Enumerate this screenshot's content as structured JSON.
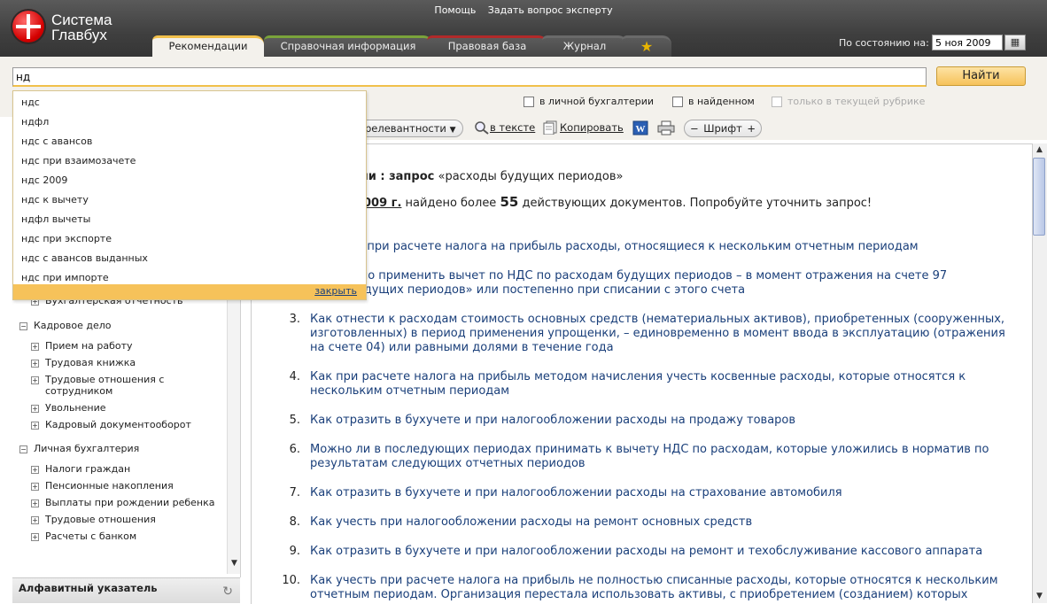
{
  "logo": {
    "line1": "Система",
    "line2": "Главбух"
  },
  "top_links": {
    "help": "Помощь",
    "ask_expert": "Задать вопрос эксперту"
  },
  "tabs": [
    {
      "label": "Рекомендации"
    },
    {
      "label": "Справочная информация"
    },
    {
      "label": "Правовая база"
    },
    {
      "label": "Журнал"
    },
    {
      "label": "★"
    }
  ],
  "date": {
    "label": "По состоянию на:",
    "value": "5 ноя 2009"
  },
  "search": {
    "value": "нд",
    "button": "Найти"
  },
  "filters": {
    "personal": "в личной бухгалтерии",
    "found": "в найденном",
    "rubric": "только в текущей рубрике"
  },
  "toolbar": {
    "sort": "релевантности",
    "in_text": "в тексте",
    "copy": "Копировать",
    "font_minus": "−",
    "font": "Шрифт",
    "font_plus": "+"
  },
  "autocomplete": {
    "items": [
      "ндс",
      "ндфл",
      "ндс с авансов",
      "ндс при взаимозачете",
      "ндс 2009",
      "ндс к вычету",
      "ндфл вычеты",
      "ндс при экспорте",
      "ндс с авансов выданных",
      "ндс при импорте"
    ],
    "close": "закрыть"
  },
  "sidebar": {
    "items": [
      {
        "label": "Бухгалтерская отчетность",
        "sign": "+"
      },
      {
        "label": "Кадровое дело",
        "sign": "−"
      },
      {
        "label": "Прием на работу",
        "sign": "+"
      },
      {
        "label": "Трудовая книжка",
        "sign": "+"
      },
      {
        "label": "Трудовые отношения с",
        "label2": "сотрудником",
        "sign": "+"
      },
      {
        "label": "Увольнение",
        "sign": "+"
      },
      {
        "label": "Кадровый документооборот",
        "sign": "+"
      },
      {
        "label": "Личная бухгалтерия",
        "sign": "−"
      },
      {
        "label": "Налоги граждан",
        "sign": "+"
      },
      {
        "label": "Пенсионные накопления",
        "sign": "+"
      },
      {
        "label": "Выплаты при рождении ребенка",
        "sign": "+"
      },
      {
        "label": "Трудовые отношения",
        "sign": "+"
      },
      {
        "label": "Расчеты с банком",
        "sign": "+"
      }
    ],
    "alpha_index": "Алфавитный указатель"
  },
  "main": {
    "heading_prefix": "ции : запрос",
    "heading_query": "«расходы будущих периодов»",
    "sub_date": "009 г.",
    "sub_text1": "найдено более",
    "sub_count": "55",
    "sub_text2": "действующих документов. Попробуйте уточнить запрос!",
    "results": [
      {
        "num": "",
        "lines": [
          "ть при расчете налога на прибыль расходы, относящиеся к нескольким отчетным периодам"
        ]
      },
      {
        "num": "",
        "lines": [
          "жно применить вычет по НДС по расходам будущих периодов – в момент отражения на счете 97",
          "будущих периодов» или постепенно при списании с этого счета"
        ]
      },
      {
        "num": "3.",
        "lines": [
          "Как отнести к расходам стоимость основных средств (нематериальных активов), приобретенных (сооруженных,",
          "изготовленных) в период применения упрощенки, – единовременно в момент ввода в эксплуатацию (отражения",
          "на счете 04) или равными долями в течение года"
        ]
      },
      {
        "num": "4.",
        "lines": [
          "Как при расчете налога на прибыль методом начисления учесть косвенные расходы, которые относятся к",
          "нескольким отчетным периодам"
        ]
      },
      {
        "num": "5.",
        "lines": [
          "Как отразить в бухучете и при налогообложении расходы на продажу товаров"
        ]
      },
      {
        "num": "6.",
        "lines": [
          "Можно ли в последующих периодах принимать к вычету НДС по расходам, которые уложились в норматив по",
          "результатам следующих отчетных периодов"
        ]
      },
      {
        "num": "7.",
        "lines": [
          "Как отразить в бухучете и при налогообложении расходы на страхование автомобиля"
        ]
      },
      {
        "num": "8.",
        "lines": [
          "Как учесть при налогообложении расходы на ремонт основных средств"
        ]
      },
      {
        "num": "9.",
        "lines": [
          "Как отразить в бухучете и при налогообложении расходы на ремонт и техобслуживание кассового аппарата"
        ]
      },
      {
        "num": "10.",
        "lines": [
          "Как учесть при расчете налога на прибыль не полностью списанные расходы, которые относятся к нескольким",
          "отчетным периодам. Организация перестала использовать активы, с приобретением (созданием) которых"
        ]
      }
    ]
  }
}
